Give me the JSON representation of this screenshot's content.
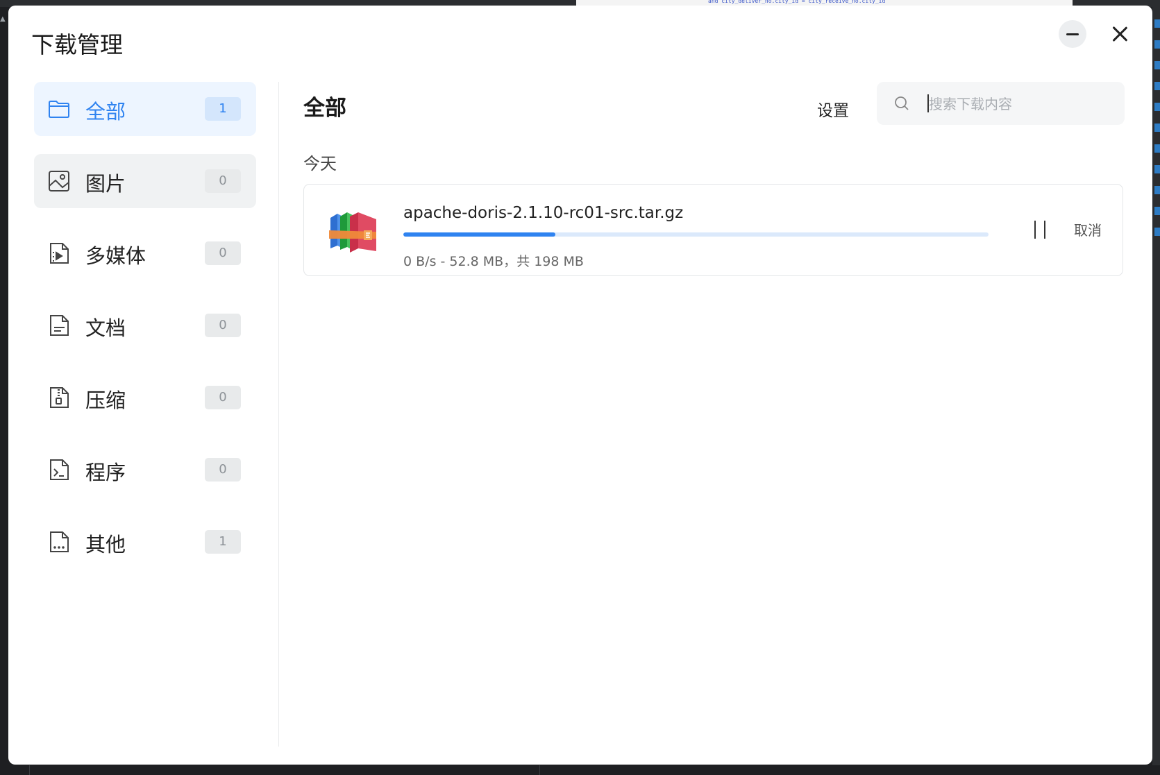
{
  "window": {
    "title": "下载管理",
    "minimize_icon": "minimize-icon",
    "close_icon": "close-icon"
  },
  "sidebar": {
    "items": [
      {
        "label": "全部",
        "count": "1",
        "icon": "folder-icon",
        "state": "active"
      },
      {
        "label": "图片",
        "count": "0",
        "icon": "image-icon",
        "state": "hover"
      },
      {
        "label": "多媒体",
        "count": "0",
        "icon": "media-icon",
        "state": ""
      },
      {
        "label": "文档",
        "count": "0",
        "icon": "document-icon",
        "state": ""
      },
      {
        "label": "压缩",
        "count": "0",
        "icon": "archive-icon",
        "state": ""
      },
      {
        "label": "程序",
        "count": "0",
        "icon": "program-icon",
        "state": ""
      },
      {
        "label": "其他",
        "count": "1",
        "icon": "other-file-icon",
        "state": ""
      }
    ]
  },
  "main": {
    "title": "全部",
    "settings_label": "设置",
    "search": {
      "placeholder": "搜索下载内容",
      "value": ""
    },
    "group_label": "今天",
    "downloads": [
      {
        "file_name": "apache-doris-2.1.10-rc01-src.tar.gz",
        "progress": 0.26,
        "status": "0 B/s - 52.8 MB，共 198 MB",
        "cancel_label": "取消",
        "file_icon": "winrar-archive-icon"
      }
    ]
  },
  "colors": {
    "accent": "#2f83f0",
    "active_bg": "#edf5ff",
    "hover_bg": "#f0f2f3",
    "progress_track": "#dbe9fb"
  }
}
